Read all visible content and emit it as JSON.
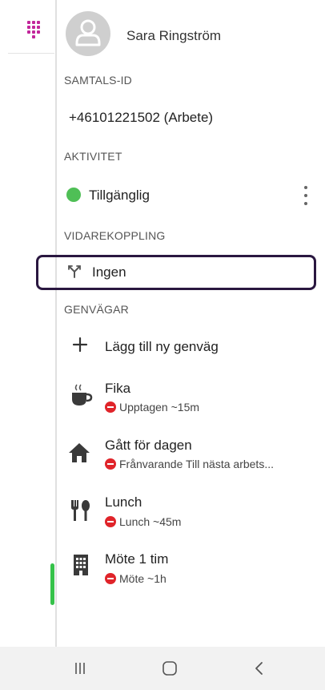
{
  "profile": {
    "name": "Sara Ringström"
  },
  "caller_id": {
    "section_label": "SAMTALS-ID",
    "value": "+46101221502 (Arbete)"
  },
  "activity": {
    "section_label": "AKTIVITET",
    "status": "Tillgänglig",
    "status_color": "#4fbf56"
  },
  "forwarding": {
    "section_label": "VIDAREKOPPLING",
    "value": "Ingen"
  },
  "shortcuts": {
    "section_label": "GENVÄGAR",
    "add_label": "Lägg till ny genväg",
    "items": [
      {
        "icon": "coffee-icon",
        "title": "Fika",
        "status": "Upptagen ~15m"
      },
      {
        "icon": "home-icon",
        "title": "Gått för dagen",
        "status": "Frånvarande Till nästa arbets..."
      },
      {
        "icon": "cutlery-icon",
        "title": "Lunch",
        "status": "Lunch ~45m"
      },
      {
        "icon": "building-icon",
        "title": "Möte 1 tim",
        "status": "Möte ~1h"
      }
    ]
  },
  "colors": {
    "accent": "#c2269b",
    "busy": "#e0242a",
    "highlight_border": "#2a1740"
  },
  "system_nav": {
    "buttons": [
      "recent-apps-icon",
      "home-icon",
      "back-icon"
    ]
  }
}
